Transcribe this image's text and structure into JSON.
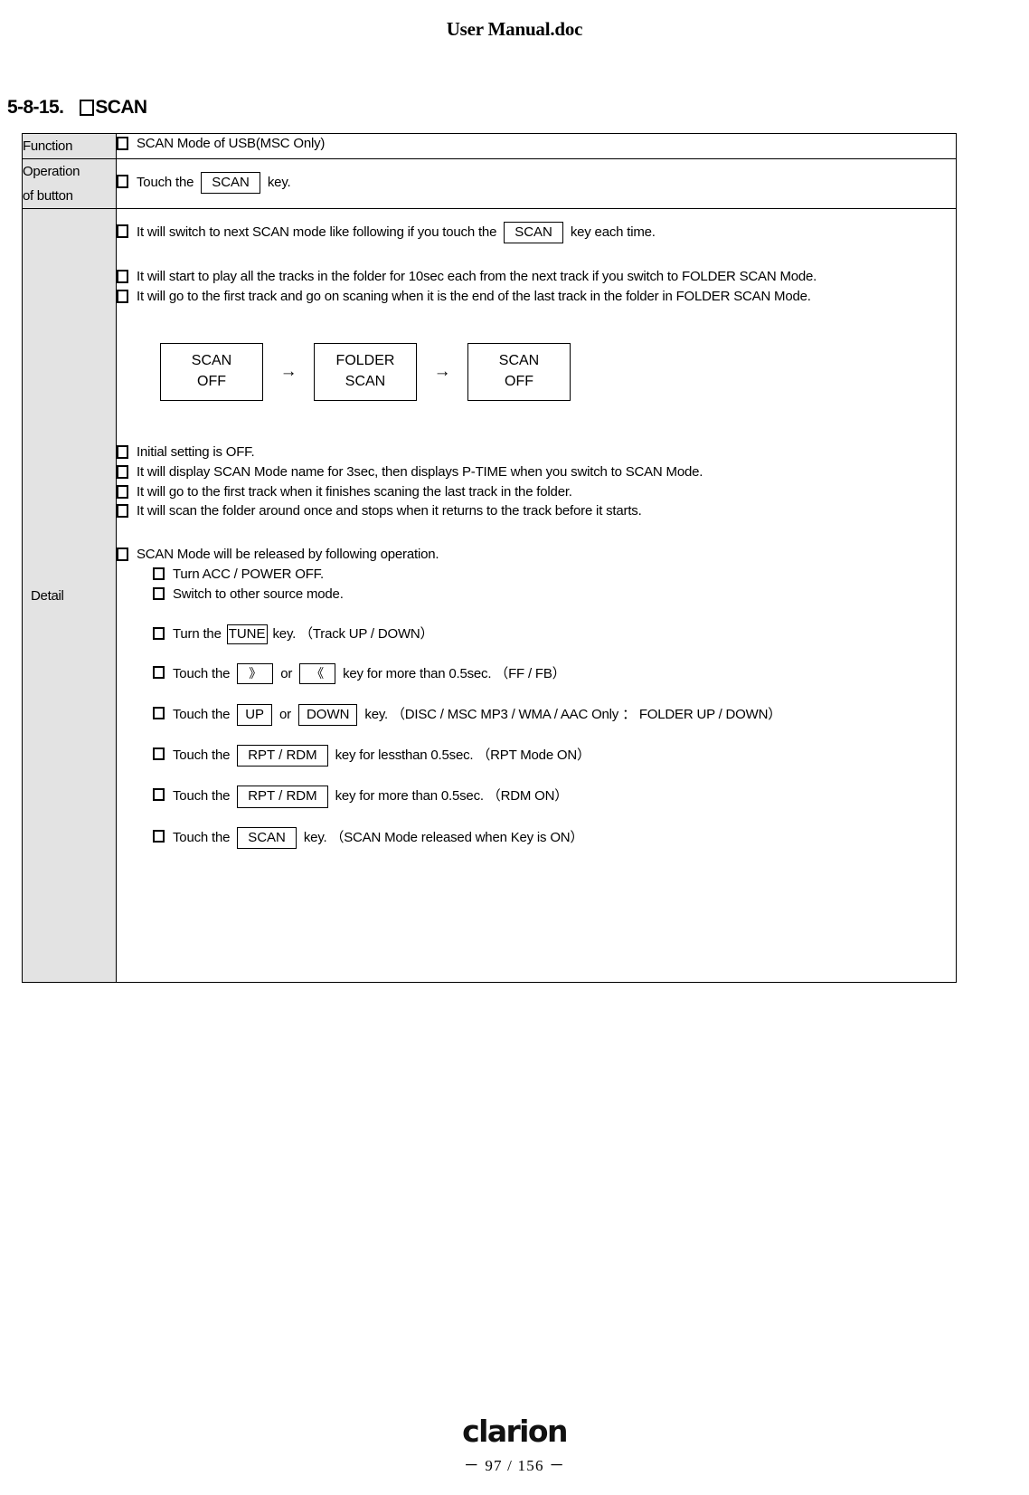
{
  "document": {
    "header_title": "User Manual.doc"
  },
  "section": {
    "number": "5-8-15.",
    "title": "SCAN"
  },
  "table": {
    "labels": {
      "function": "Function",
      "operation_line1": "Operation",
      "operation_line2": "of button",
      "detail": "Detail"
    },
    "function_row": {
      "text": "SCAN Mode of USB(MSC Only)"
    },
    "operation_row": {
      "prefix": "Touch the",
      "key": "SCAN",
      "suffix": "key."
    },
    "detail": {
      "intro": {
        "prefix": "It will switch to next SCAN mode like following if you touch the",
        "key": "SCAN",
        "suffix": "key each time."
      },
      "bullets_top": [
        "It will start to play all the tracks in the folder for 10sec each from the next track if you switch to FOLDER SCAN Mode.",
        "It will go to the first track and go on scaning when it is the end of the last track in the folder in FOLDER SCAN Mode."
      ],
      "flow": {
        "boxes": [
          {
            "line1": "SCAN",
            "line2": "OFF"
          },
          {
            "line1": "FOLDER",
            "line2": "SCAN"
          },
          {
            "line1": "SCAN",
            "line2": "OFF"
          }
        ],
        "arrow": "→"
      },
      "bullets_mid": [
        "Initial setting is OFF.",
        "It will display SCAN Mode name for 3sec, then displays P-TIME when you switch to SCAN Mode.",
        "It will go to the first track when it finishes scaning the last track in the folder.",
        "It will scan the folder around once and stops when it returns to the track before it starts."
      ],
      "release_heading": "SCAN Mode will be released by following operation.",
      "release_items": [
        {
          "type": "plain",
          "text": "Turn ACC / POWER  OFF."
        },
        {
          "type": "plain",
          "text": "Switch to other source mode."
        },
        {
          "type": "key",
          "prefix": "Turn the",
          "key1": "TUNE",
          "key1_style": "tight",
          "mid": "",
          "key2": "",
          "suffix": "key. （Track UP / DOWN）"
        },
        {
          "type": "key2",
          "prefix": "Touch the",
          "key1": "》",
          "key1_style": "arrow",
          "mid": "or",
          "key2": "《",
          "key2_style": "arrow",
          "suffix": "key for more than 0.5sec. （FF / FB）"
        },
        {
          "type": "key2",
          "prefix": "Touch the",
          "key1": "UP",
          "key1_style": "wide",
          "mid": "or",
          "key2": "DOWN",
          "key2_style": "wide",
          "suffix": "key. （DISC / MSC MP3 / WMA / AAC Only  ：  FOLDER UP / DOWN）"
        },
        {
          "type": "key",
          "prefix": "Touch the",
          "key1": "RPT / RDM",
          "key1_style": "",
          "mid": "",
          "key2": "",
          "suffix": "key for lessthan 0.5sec. （RPT Mode ON）"
        },
        {
          "type": "key",
          "prefix": "Touch the",
          "key1": "RPT / RDM",
          "key1_style": "",
          "mid": "",
          "key2": "",
          "suffix": "key for more than 0.5sec. （RDM ON）"
        },
        {
          "type": "key",
          "prefix": "Touch the",
          "key1": "SCAN",
          "key1_style": "",
          "mid": "",
          "key2": "",
          "suffix": "key. （SCAN Mode released when Key is ON）"
        }
      ]
    }
  },
  "footer": {
    "logo_text": "clarion",
    "page_number": "－ 97 / 156 －"
  }
}
